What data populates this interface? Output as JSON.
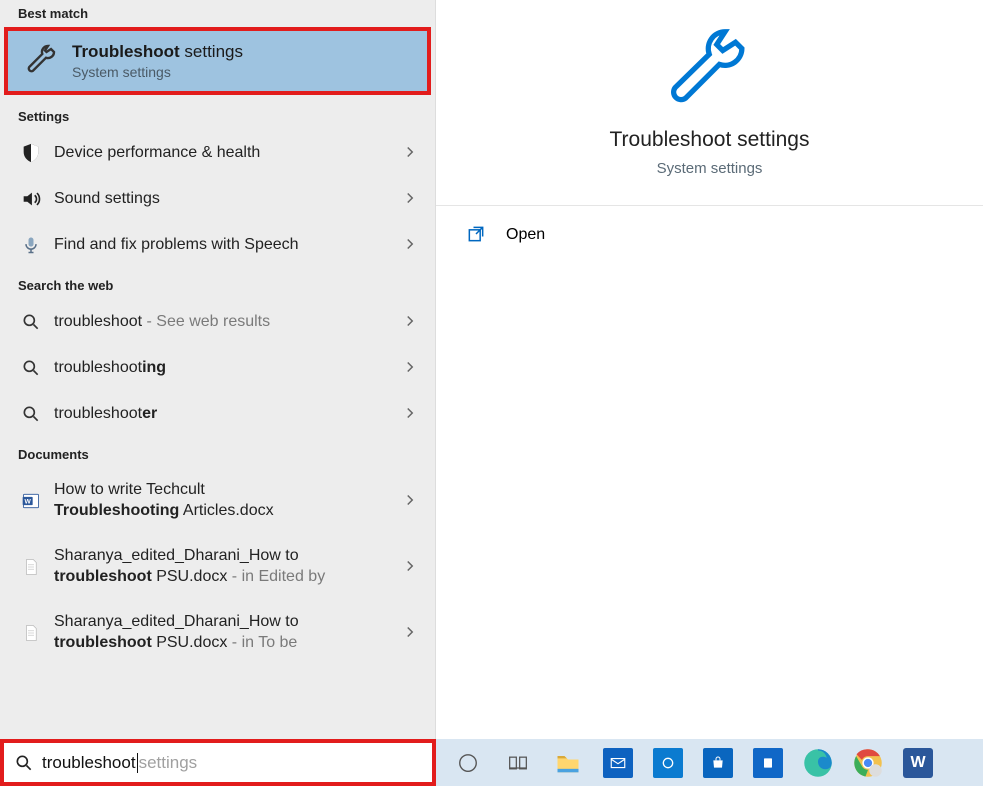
{
  "sections": {
    "best_match": "Best match",
    "settings": "Settings",
    "web": "Search the web",
    "documents": "Documents"
  },
  "best_match": {
    "title_bold": "Troubleshoot",
    "title_rest": " settings",
    "subtitle": "System settings"
  },
  "settings_items": [
    {
      "label": "Device performance & health",
      "icon": "shield"
    },
    {
      "label": "Sound settings",
      "icon": "sound"
    },
    {
      "label": "Find and fix problems with Speech",
      "icon": "mic"
    }
  ],
  "web_items": [
    {
      "pre": "troubleshoot",
      "bold": "",
      "suffix": " - See web results"
    },
    {
      "pre": "troubleshoot",
      "bold": "ing",
      "suffix": ""
    },
    {
      "pre": "troubleshoot",
      "bold": "er",
      "suffix": ""
    }
  ],
  "documents_items": [
    {
      "line1": "How to write Techcult",
      "line2_pre": "",
      "line2_bold": "Troubleshooting",
      "line2_rest": " Articles.docx",
      "line2_suffix": ""
    },
    {
      "line1": "Sharanya_edited_Dharani_How to",
      "line2_pre": "",
      "line2_bold": "troubleshoot",
      "line2_rest": " PSU.docx",
      "line2_suffix": " - in Edited by"
    },
    {
      "line1": "Sharanya_edited_Dharani_How to",
      "line2_pre": "",
      "line2_bold": "troubleshoot",
      "line2_rest": " PSU.docx",
      "line2_suffix": " - in To be"
    }
  ],
  "preview": {
    "title_bold": "Troubleshoot",
    "title_rest": " settings",
    "subtitle": "System settings",
    "actions": {
      "open": "Open"
    }
  },
  "search": {
    "typed": "troubleshoot",
    "ghost": " settings"
  }
}
